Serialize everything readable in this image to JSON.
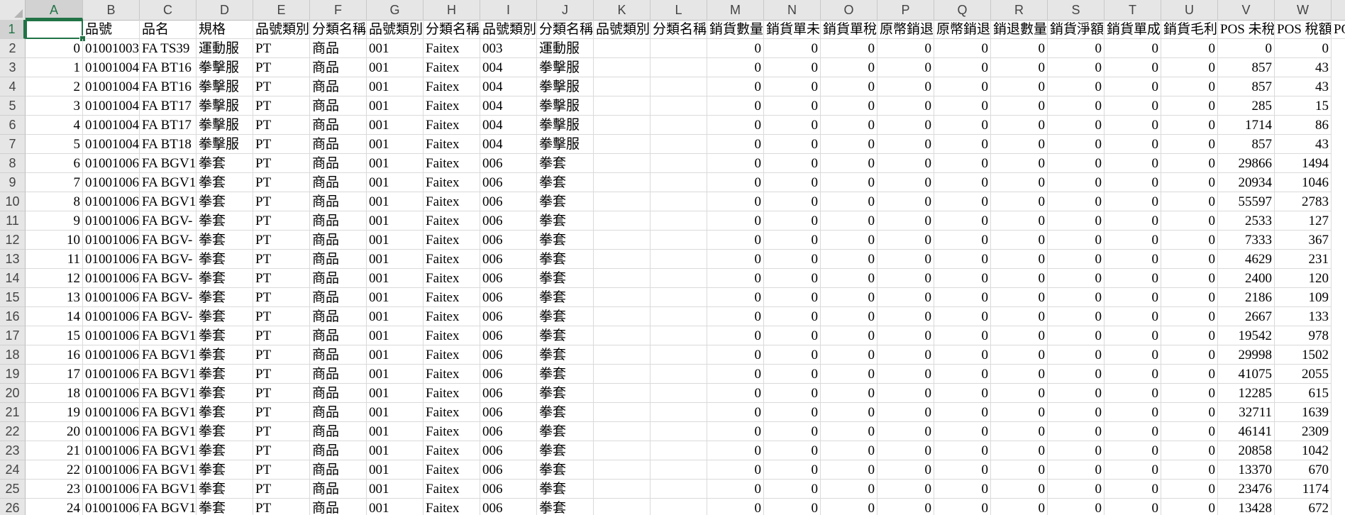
{
  "columns": [
    "A",
    "B",
    "C",
    "D",
    "E",
    "F",
    "G",
    "H",
    "I",
    "J",
    "K",
    "L",
    "M",
    "N",
    "O",
    "P",
    "Q",
    "R",
    "S",
    "T",
    "U",
    "V",
    "W"
  ],
  "selected_column": "A",
  "selected_row": 1,
  "header_row": [
    "",
    "品號",
    "品名",
    "規格",
    "品號類別",
    "分類名稱",
    "品號類別",
    "分類名稱",
    "品號類別",
    "分類名稱",
    "品號類別",
    "分類名稱",
    "銷貨數量",
    "銷貨單未",
    "銷貨單稅",
    "原幣銷退",
    "原幣銷退",
    "銷退數量",
    "銷貨淨額",
    "銷貨單成",
    "銷貨毛利",
    "POS 未稅",
    "POS 稅額"
  ],
  "overflow_text": "PO",
  "rows": [
    {
      "row": 2,
      "cells": [
        "0",
        "01001003",
        "FA TS39",
        "運動服",
        "PT",
        "商品",
        "001",
        "Faitex",
        "003",
        "運動服",
        "",
        "",
        "0",
        "0",
        "0",
        "0",
        "0",
        "0",
        "0",
        "0",
        "0",
        "0",
        "0"
      ]
    },
    {
      "row": 3,
      "cells": [
        "1",
        "01001004",
        "FA BT16",
        "拳擊服",
        "PT",
        "商品",
        "001",
        "Faitex",
        "004",
        "拳擊服",
        "",
        "",
        "0",
        "0",
        "0",
        "0",
        "0",
        "0",
        "0",
        "0",
        "0",
        "857",
        "43"
      ]
    },
    {
      "row": 4,
      "cells": [
        "2",
        "01001004",
        "FA BT16",
        "拳擊服",
        "PT",
        "商品",
        "001",
        "Faitex",
        "004",
        "拳擊服",
        "",
        "",
        "0",
        "0",
        "0",
        "0",
        "0",
        "0",
        "0",
        "0",
        "0",
        "857",
        "43"
      ]
    },
    {
      "row": 5,
      "cells": [
        "3",
        "01001004",
        "FA BT17",
        "拳擊服",
        "PT",
        "商品",
        "001",
        "Faitex",
        "004",
        "拳擊服",
        "",
        "",
        "0",
        "0",
        "0",
        "0",
        "0",
        "0",
        "0",
        "0",
        "0",
        "285",
        "15"
      ]
    },
    {
      "row": 6,
      "cells": [
        "4",
        "01001004",
        "FA BT17",
        "拳擊服",
        "PT",
        "商品",
        "001",
        "Faitex",
        "004",
        "拳擊服",
        "",
        "",
        "0",
        "0",
        "0",
        "0",
        "0",
        "0",
        "0",
        "0",
        "0",
        "1714",
        "86"
      ]
    },
    {
      "row": 7,
      "cells": [
        "5",
        "01001004",
        "FA BT18",
        "拳擊服",
        "PT",
        "商品",
        "001",
        "Faitex",
        "004",
        "拳擊服",
        "",
        "",
        "0",
        "0",
        "0",
        "0",
        "0",
        "0",
        "0",
        "0",
        "0",
        "857",
        "43"
      ]
    },
    {
      "row": 8,
      "cells": [
        "6",
        "01001006",
        "FA BGV1",
        "拳套",
        "PT",
        "商品",
        "001",
        "Faitex",
        "006",
        "拳套",
        "",
        "",
        "0",
        "0",
        "0",
        "0",
        "0",
        "0",
        "0",
        "0",
        "0",
        "29866",
        "1494"
      ]
    },
    {
      "row": 9,
      "cells": [
        "7",
        "01001006",
        "FA BGV1",
        "拳套",
        "PT",
        "商品",
        "001",
        "Faitex",
        "006",
        "拳套",
        "",
        "",
        "0",
        "0",
        "0",
        "0",
        "0",
        "0",
        "0",
        "0",
        "0",
        "20934",
        "1046"
      ]
    },
    {
      "row": 10,
      "cells": [
        "8",
        "01001006",
        "FA BGV1",
        "拳套",
        "PT",
        "商品",
        "001",
        "Faitex",
        "006",
        "拳套",
        "",
        "",
        "0",
        "0",
        "0",
        "0",
        "0",
        "0",
        "0",
        "0",
        "0",
        "55597",
        "2783"
      ]
    },
    {
      "row": 11,
      "cells": [
        "9",
        "01001006",
        "FA BGV-",
        "拳套",
        "PT",
        "商品",
        "001",
        "Faitex",
        "006",
        "拳套",
        "",
        "",
        "0",
        "0",
        "0",
        "0",
        "0",
        "0",
        "0",
        "0",
        "0",
        "2533",
        "127"
      ]
    },
    {
      "row": 12,
      "cells": [
        "10",
        "01001006",
        "FA BGV-",
        "拳套",
        "PT",
        "商品",
        "001",
        "Faitex",
        "006",
        "拳套",
        "",
        "",
        "0",
        "0",
        "0",
        "0",
        "0",
        "0",
        "0",
        "0",
        "0",
        "7333",
        "367"
      ]
    },
    {
      "row": 13,
      "cells": [
        "11",
        "01001006",
        "FA BGV-",
        "拳套",
        "PT",
        "商品",
        "001",
        "Faitex",
        "006",
        "拳套",
        "",
        "",
        "0",
        "0",
        "0",
        "0",
        "0",
        "0",
        "0",
        "0",
        "0",
        "4629",
        "231"
      ]
    },
    {
      "row": 14,
      "cells": [
        "12",
        "01001006",
        "FA BGV-",
        "拳套",
        "PT",
        "商品",
        "001",
        "Faitex",
        "006",
        "拳套",
        "",
        "",
        "0",
        "0",
        "0",
        "0",
        "0",
        "0",
        "0",
        "0",
        "0",
        "2400",
        "120"
      ]
    },
    {
      "row": 15,
      "cells": [
        "13",
        "01001006",
        "FA BGV-",
        "拳套",
        "PT",
        "商品",
        "001",
        "Faitex",
        "006",
        "拳套",
        "",
        "",
        "0",
        "0",
        "0",
        "0",
        "0",
        "0",
        "0",
        "0",
        "0",
        "2186",
        "109"
      ]
    },
    {
      "row": 16,
      "cells": [
        "14",
        "01001006",
        "FA BGV-",
        "拳套",
        "PT",
        "商品",
        "001",
        "Faitex",
        "006",
        "拳套",
        "",
        "",
        "0",
        "0",
        "0",
        "0",
        "0",
        "0",
        "0",
        "0",
        "0",
        "2667",
        "133"
      ]
    },
    {
      "row": 17,
      "cells": [
        "15",
        "01001006",
        "FA BGV1",
        "拳套",
        "PT",
        "商品",
        "001",
        "Faitex",
        "006",
        "拳套",
        "",
        "",
        "0",
        "0",
        "0",
        "0",
        "0",
        "0",
        "0",
        "0",
        "0",
        "19542",
        "978"
      ]
    },
    {
      "row": 18,
      "cells": [
        "16",
        "01001006",
        "FA BGV1",
        "拳套",
        "PT",
        "商品",
        "001",
        "Faitex",
        "006",
        "拳套",
        "",
        "",
        "0",
        "0",
        "0",
        "0",
        "0",
        "0",
        "0",
        "0",
        "0",
        "29998",
        "1502"
      ]
    },
    {
      "row": 19,
      "cells": [
        "17",
        "01001006",
        "FA BGV1",
        "拳套",
        "PT",
        "商品",
        "001",
        "Faitex",
        "006",
        "拳套",
        "",
        "",
        "0",
        "0",
        "0",
        "0",
        "0",
        "0",
        "0",
        "0",
        "0",
        "41075",
        "2055"
      ]
    },
    {
      "row": 20,
      "cells": [
        "18",
        "01001006",
        "FA BGV1",
        "拳套",
        "PT",
        "商品",
        "001",
        "Faitex",
        "006",
        "拳套",
        "",
        "",
        "0",
        "0",
        "0",
        "0",
        "0",
        "0",
        "0",
        "0",
        "0",
        "12285",
        "615"
      ]
    },
    {
      "row": 21,
      "cells": [
        "19",
        "01001006",
        "FA BGV1",
        "拳套",
        "PT",
        "商品",
        "001",
        "Faitex",
        "006",
        "拳套",
        "",
        "",
        "0",
        "0",
        "0",
        "0",
        "0",
        "0",
        "0",
        "0",
        "0",
        "32711",
        "1639"
      ]
    },
    {
      "row": 22,
      "cells": [
        "20",
        "01001006",
        "FA BGV1",
        "拳套",
        "PT",
        "商品",
        "001",
        "Faitex",
        "006",
        "拳套",
        "",
        "",
        "0",
        "0",
        "0",
        "0",
        "0",
        "0",
        "0",
        "0",
        "0",
        "46141",
        "2309"
      ]
    },
    {
      "row": 23,
      "cells": [
        "21",
        "01001006",
        "FA BGV1",
        "拳套",
        "PT",
        "商品",
        "001",
        "Faitex",
        "006",
        "拳套",
        "",
        "",
        "0",
        "0",
        "0",
        "0",
        "0",
        "0",
        "0",
        "0",
        "0",
        "20858",
        "1042"
      ]
    },
    {
      "row": 24,
      "cells": [
        "22",
        "01001006",
        "FA BGV1",
        "拳套",
        "PT",
        "商品",
        "001",
        "Faitex",
        "006",
        "拳套",
        "",
        "",
        "0",
        "0",
        "0",
        "0",
        "0",
        "0",
        "0",
        "0",
        "0",
        "13370",
        "670"
      ]
    },
    {
      "row": 25,
      "cells": [
        "23",
        "01001006",
        "FA BGV1",
        "拳套",
        "PT",
        "商品",
        "001",
        "Faitex",
        "006",
        "拳套",
        "",
        "",
        "0",
        "0",
        "0",
        "0",
        "0",
        "0",
        "0",
        "0",
        "0",
        "23476",
        "1174"
      ]
    },
    {
      "row": 26,
      "cells": [
        "24",
        "01001006",
        "FA BGV1",
        "拳套",
        "PT",
        "商品",
        "001",
        "Faitex",
        "006",
        "拳套",
        "",
        "",
        "0",
        "0",
        "0",
        "0",
        "0",
        "0",
        "0",
        "0",
        "0",
        "13428",
        "672"
      ]
    }
  ],
  "colors": {
    "accent": "#217346",
    "header_bg": "#e6e6e6",
    "gridline": "#dadada"
  }
}
